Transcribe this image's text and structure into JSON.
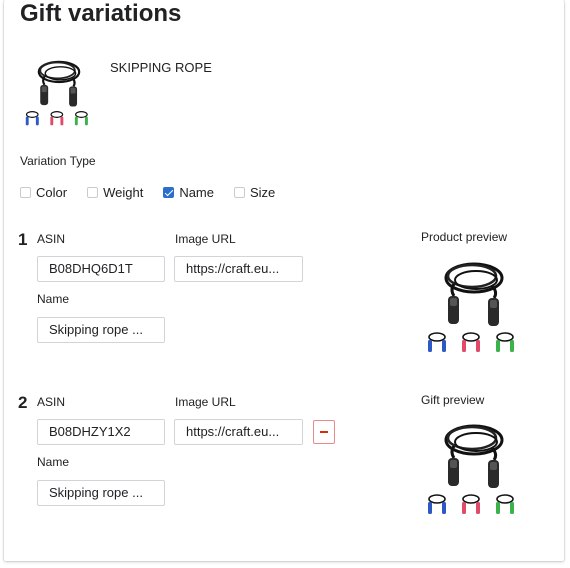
{
  "page": {
    "title": "Gift variations"
  },
  "product": {
    "name": "SKIPPING ROPE",
    "image_icon": "skipping-rope-image"
  },
  "variation_type": {
    "label": "Variation Type",
    "options": [
      {
        "label": "Color",
        "checked": false
      },
      {
        "label": "Weight",
        "checked": false
      },
      {
        "label": "Name",
        "checked": true
      },
      {
        "label": "Size",
        "checked": false
      }
    ]
  },
  "variations": [
    {
      "number": "1",
      "asin_label": "ASIN",
      "asin": "B08DHQ6D1T",
      "image_url_label": "Image URL",
      "image_url": "https://craft.eu...",
      "name_label": "Name",
      "name": "Skipping rope ...",
      "preview_label": "Product preview"
    },
    {
      "number": "2",
      "asin_label": "ASIN",
      "asin": "B08DHZY1X2",
      "image_url_label": "Image URL",
      "image_url": "https://craft.eu...",
      "name_label": "Name",
      "name": "Skipping rope ...",
      "preview_label": "Gift preview",
      "remove_icon": "minus-icon"
    }
  ],
  "colors": {
    "accent": "#2c6ecb",
    "danger": "#d72c0d"
  }
}
